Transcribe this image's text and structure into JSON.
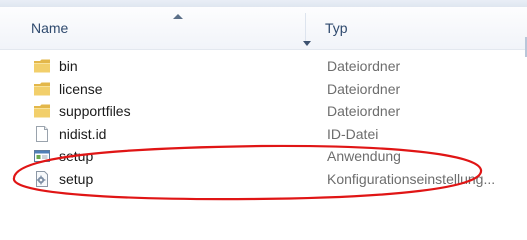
{
  "columns": {
    "name": "Name",
    "type": "Typ"
  },
  "files": [
    {
      "name": "bin",
      "type": "Dateiordner",
      "icon": "folder-icon"
    },
    {
      "name": "license",
      "type": "Dateiordner",
      "icon": "folder-icon"
    },
    {
      "name": "supportfiles",
      "type": "Dateiordner",
      "icon": "folder-icon"
    },
    {
      "name": "nidist.id",
      "type": "ID-Datei",
      "icon": "generic-file-icon"
    },
    {
      "name": "setup",
      "type": "Anwendung",
      "icon": "application-icon"
    },
    {
      "name": "setup",
      "type": "Konfigurationseinstellung...",
      "icon": "settings-file-icon"
    }
  ],
  "colors": {
    "header_text": "#2f4a6e",
    "type_text": "#6d6d6d",
    "annotation_circle": "#e01515"
  }
}
